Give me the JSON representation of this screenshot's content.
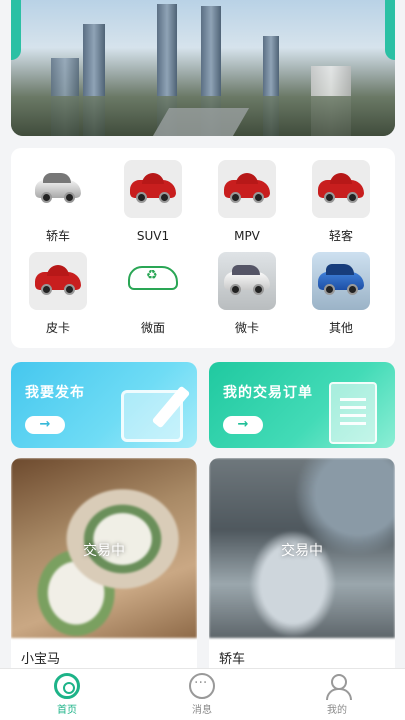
{
  "categories": [
    {
      "label": "轿车",
      "icon": "sedan-car-icon"
    },
    {
      "label": "SUV1",
      "icon": "suv-car-icon"
    },
    {
      "label": "MPV",
      "icon": "mpv-car-icon"
    },
    {
      "label": "轻客",
      "icon": "light-bus-icon"
    },
    {
      "label": "皮卡",
      "icon": "pickup-car-icon"
    },
    {
      "label": "微面",
      "icon": "mini-van-icon"
    },
    {
      "label": "微卡",
      "icon": "mini-truck-icon"
    },
    {
      "label": "其他",
      "icon": "other-car-icon"
    }
  ],
  "actions": {
    "publish": {
      "title": "我要发布",
      "arrow": "→",
      "icon": "edit-icon"
    },
    "orders": {
      "title": "我的交易订单",
      "arrow": "→",
      "icon": "document-icon"
    }
  },
  "listings": [
    {
      "name": "小宝马",
      "status": "交易中"
    },
    {
      "name": "轿车",
      "status": "交易中"
    }
  ],
  "tabbar": {
    "home": "首页",
    "messages": "消息",
    "mine": "我的"
  },
  "colors": {
    "accent": "#1db388",
    "blue_card": "#45c7ee",
    "green_card": "#20c9a0"
  }
}
